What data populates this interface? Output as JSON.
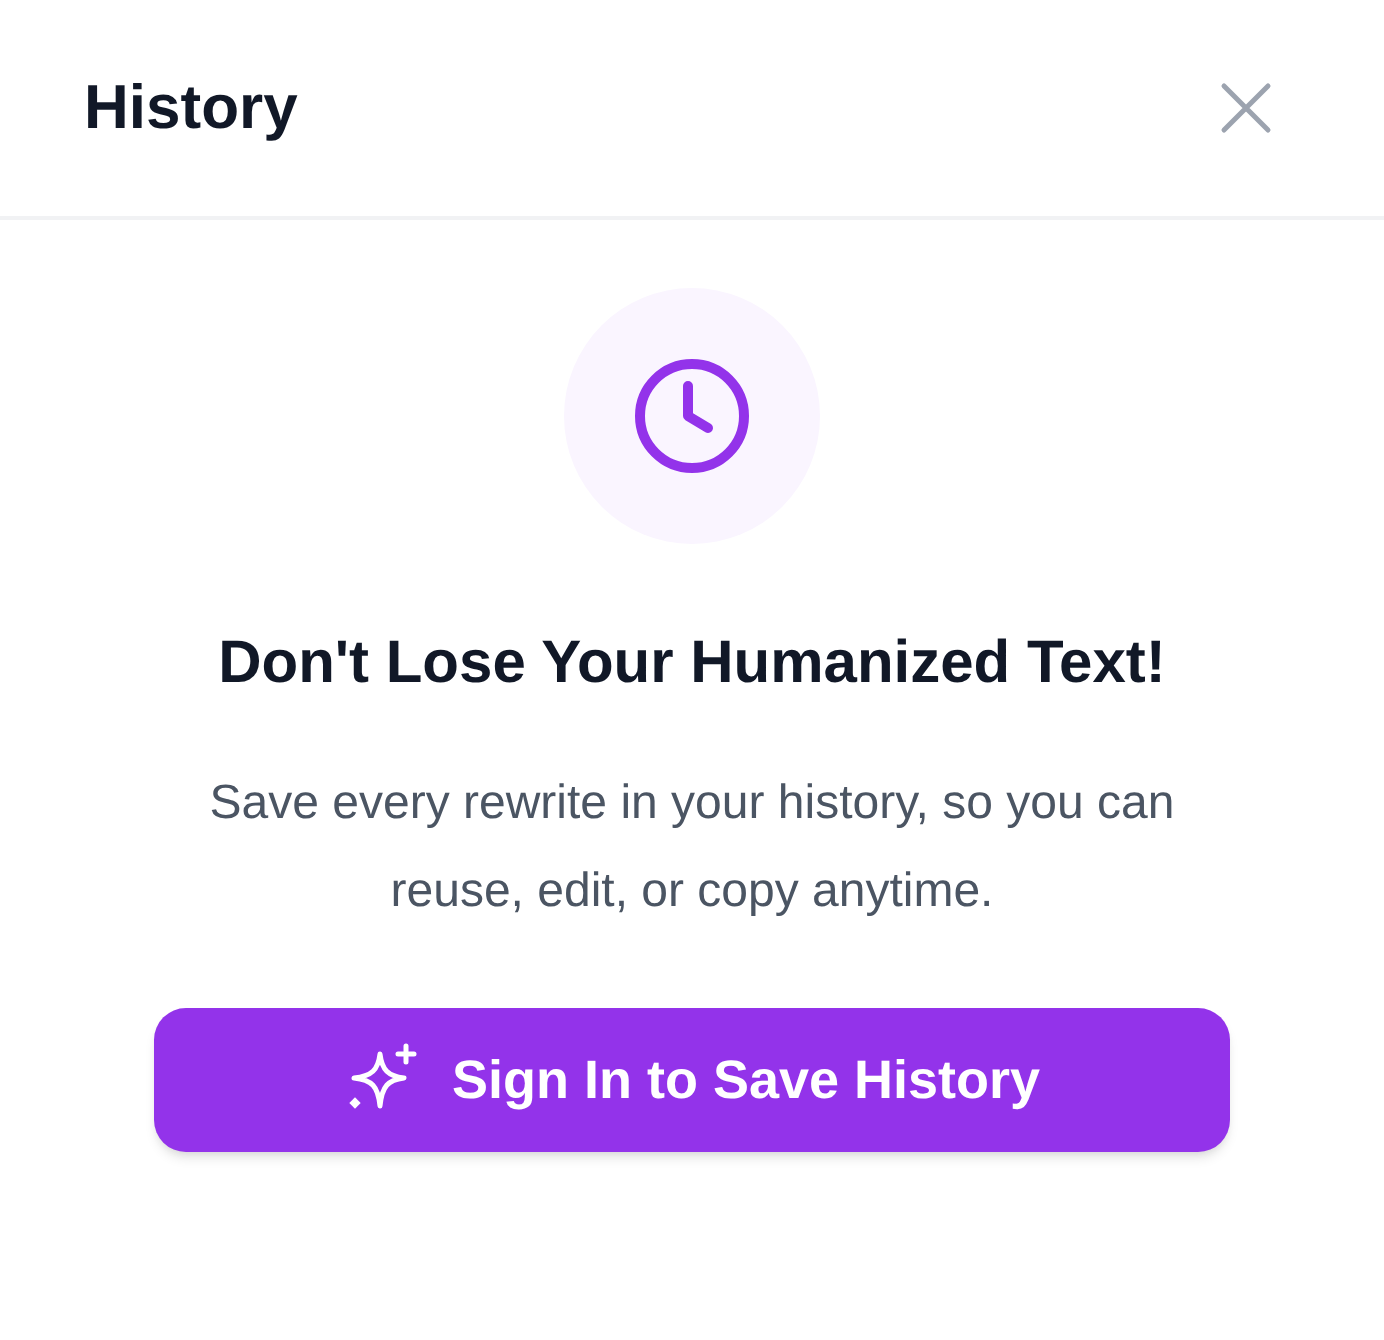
{
  "header": {
    "title": "History"
  },
  "empty_state": {
    "heading": "Don't Lose Your Humanized Text!",
    "description": "Save every rewrite in your history, so you can reuse, edit, or copy anytime."
  },
  "button": {
    "label": "Sign In to Save History"
  }
}
